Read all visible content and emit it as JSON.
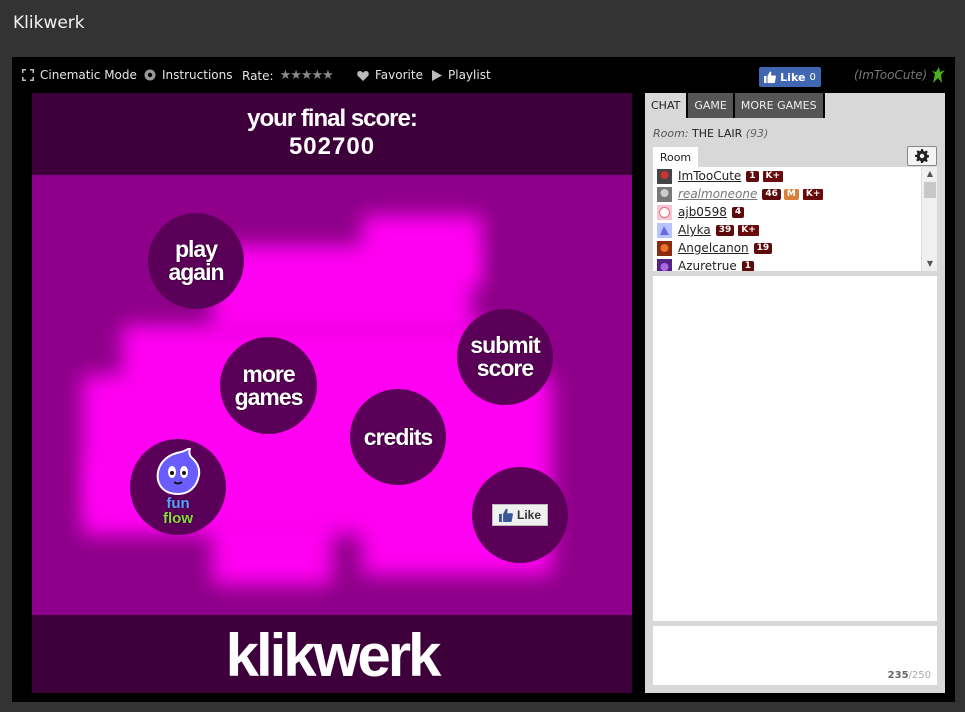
{
  "page": {
    "title": "Klikwerk"
  },
  "toolbar": {
    "cinematic_label": "Cinematic Mode",
    "instructions_label": "Instructions",
    "rate_label": "Rate:",
    "stars": "★★★★★",
    "favorite_label": "Favorite",
    "playlist_label": "Playlist",
    "fb_like_label": "Like",
    "fb_like_count": "0",
    "username": "(ImTooCute)"
  },
  "game": {
    "score_label": "your final score:",
    "score_value": "502700",
    "buttons": {
      "play_again_1": "play",
      "play_again_2": "again",
      "more_games_1": "more",
      "more_games_2": "games",
      "submit_score_1": "submit",
      "submit_score_2": "score",
      "credits": "credits",
      "like": "Like",
      "funflow_fun": "fun",
      "funflow_flow": "flow"
    },
    "logo": "klikwerk"
  },
  "panel": {
    "tabs": [
      "CHAT",
      "GAME",
      "MORE GAMES"
    ],
    "room_label": "Room:",
    "room_name": "THE LAIR",
    "room_count": "(93)",
    "room_tab": "Room",
    "users": [
      {
        "name": "ImTooCute",
        "level": "1",
        "badge2": "K+"
      },
      {
        "name": "realmoneone",
        "level": "46",
        "badge2": "M",
        "badge3": "K+"
      },
      {
        "name": "ajb0598",
        "level": "4"
      },
      {
        "name": "Alyka",
        "level": "39",
        "badge2": "K+"
      },
      {
        "name": "Angelcanon",
        "level": "19"
      },
      {
        "name": "Azuretrue",
        "level": "1"
      }
    ],
    "char_used": "235",
    "char_max": "/250"
  },
  "colors": {
    "accent_magenta": "#ff00f2",
    "game_bg": "#8e0089",
    "header_bg": "#3d003b",
    "fb_blue": "#4267b2",
    "badge": "#5c0a0a"
  }
}
